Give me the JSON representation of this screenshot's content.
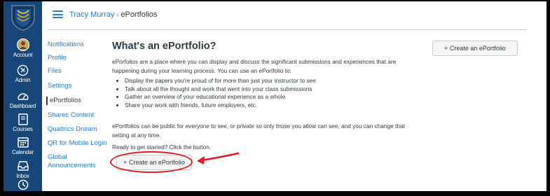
{
  "breadcrumb": {
    "user": "Tracy Murray",
    "separator": "›",
    "current": "ePortfolios"
  },
  "global_nav": [
    {
      "label": "Account",
      "icon": "avatar-icon"
    },
    {
      "label": "Admin",
      "icon": "shield-icon"
    },
    {
      "label": "Dashboard",
      "icon": "speedometer-icon"
    },
    {
      "label": "Courses",
      "icon": "book-icon"
    },
    {
      "label": "Calendar",
      "icon": "calendar-icon"
    },
    {
      "label": "Inbox",
      "icon": "inbox-icon"
    },
    {
      "label": "",
      "icon": "history-icon"
    }
  ],
  "course_nav": [
    {
      "label": "Notifications"
    },
    {
      "label": "Profile"
    },
    {
      "label": "Files"
    },
    {
      "label": "Settings"
    },
    {
      "label": "ePortfolios"
    },
    {
      "label": "Sharec Content"
    },
    {
      "label": "Qualtrics Drieam"
    },
    {
      "label": "QR for Mobile Login"
    },
    {
      "label": "Global"
    },
    {
      "label": "Announcements"
    }
  ],
  "main": {
    "title": "What's an ePortfolio?",
    "intro_line1": "ePorfolios are a place where you can display and discuss the significant submissions and experiences that are",
    "intro_line2": "happening during your learning process. You can use an ePortfolio to:",
    "bullets": [
      "Display the papers you're proud of for more than just your instructor to see",
      "Talk about all the thought and work that went into your class submissions",
      "Gather an overview of your educational experience as a whole",
      "Share your work with friends, future employers, etc."
    ],
    "privacy_line1": "ePortfolios can be public for everyone to see, or private so only those you allow can see, and you can change that",
    "privacy_line2": "setting at any time.",
    "ready_text": "Ready to get started? Click the button.",
    "create_button": "+ Create an ePortfolio"
  },
  "sidebar": {
    "create_button": "+ Create an ePortfolio"
  },
  "colors": {
    "nav_bg": "#164778",
    "link": "#2a7bbf",
    "annotation": "#e51b23"
  }
}
